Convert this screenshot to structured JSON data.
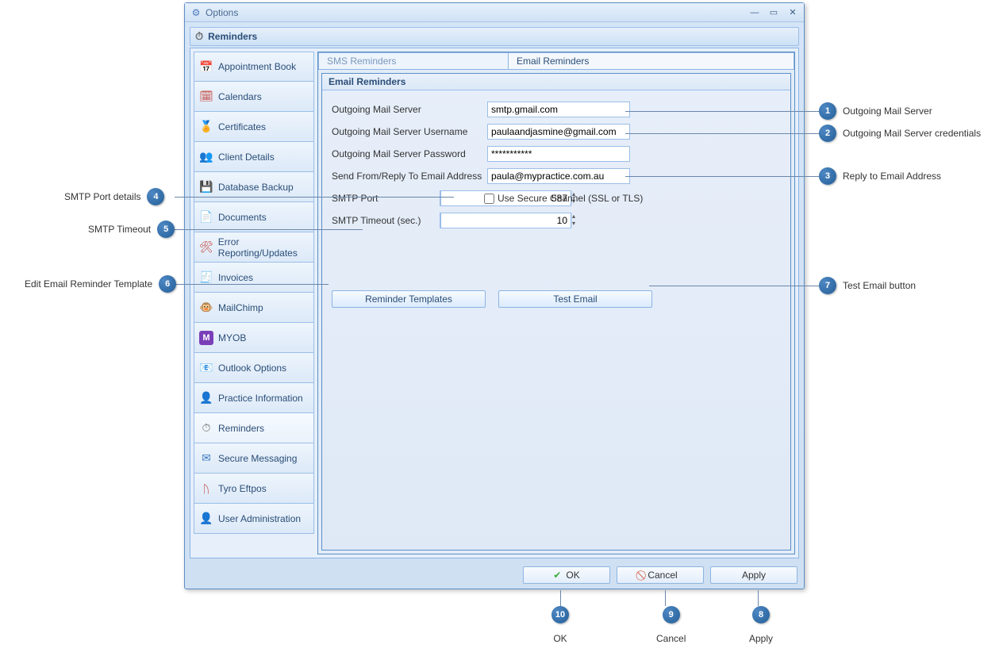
{
  "window": {
    "title": "Options"
  },
  "header": {
    "title": "Reminders"
  },
  "sidebar": {
    "items": [
      {
        "label": "Appointment Book",
        "icon": "📅",
        "color": "#3c78c2"
      },
      {
        "label": "Calendars",
        "icon": "🗓",
        "color": "#c2443c"
      },
      {
        "label": "Certificates",
        "icon": "🏅",
        "color": "#d9a441"
      },
      {
        "label": "Client Details",
        "icon": "👥",
        "color": "#3c78c2"
      },
      {
        "label": "Database Backup",
        "icon": "💾",
        "color": "#6b6b6b"
      },
      {
        "label": "Documents",
        "icon": "📄",
        "color": "#b9c4d1"
      },
      {
        "label": "Error Reporting/Updates",
        "icon": "🛠",
        "color": "#c2443c"
      },
      {
        "label": "Invoices",
        "icon": "🧾",
        "color": "#3ca24a"
      },
      {
        "label": "MailChimp",
        "icon": "🐵",
        "color": "#d9a441"
      },
      {
        "label": "MYOB",
        "icon": "M",
        "color": "#7a3fb8",
        "badge": true
      },
      {
        "label": "Outlook Options",
        "icon": "📧",
        "color": "#d9a441"
      },
      {
        "label": "Practice Information",
        "icon": "👤",
        "color": "#3c78c2"
      },
      {
        "label": "Reminders",
        "icon": "⏱",
        "color": "#6b6b6b",
        "selected": true
      },
      {
        "label": "Secure Messaging",
        "icon": "✉",
        "color": "#3c78c2"
      },
      {
        "label": "Tyro Eftpos",
        "icon": "ᚢ",
        "color": "#c2443c"
      },
      {
        "label": "User Administration",
        "icon": "👤",
        "color": "#5b8ec7"
      }
    ]
  },
  "tabs": {
    "sms": "SMS Reminders",
    "email": "Email Reminders"
  },
  "panel": {
    "title": "Email Reminders"
  },
  "form": {
    "server_label": "Outgoing Mail Server",
    "server_value": "smtp.gmail.com",
    "user_label": "Outgoing Mail Server Username",
    "user_value": "paulaandjasmine@gmail.com",
    "pass_label": "Outgoing Mail Server Password",
    "pass_value": "***********",
    "from_label": "Send From/Reply To Email Address",
    "from_value": "paula@mypractice.com.au",
    "port_label": "SMTP Port",
    "port_value": "587",
    "ssl_label": "Use Secure Channel (SSL or TLS)",
    "timeout_label": "SMTP Timeout (sec.)",
    "timeout_value": "10",
    "btn_templates": "Reminder Templates",
    "btn_test": "Test Email"
  },
  "dlg": {
    "ok": "OK",
    "cancel": "Cancel",
    "apply": "Apply"
  },
  "callouts": {
    "c1": "Outgoing Mail Server",
    "c2": "Outgoing Mail Server credentials",
    "c3": "Reply to Email Address",
    "c4": "SMTP Port details",
    "c5": "SMTP Timeout",
    "c6": "Edit Email Reminder Template",
    "c7": "Test Email button",
    "c8": "Apply",
    "c9": "Cancel",
    "c10": "OK"
  }
}
